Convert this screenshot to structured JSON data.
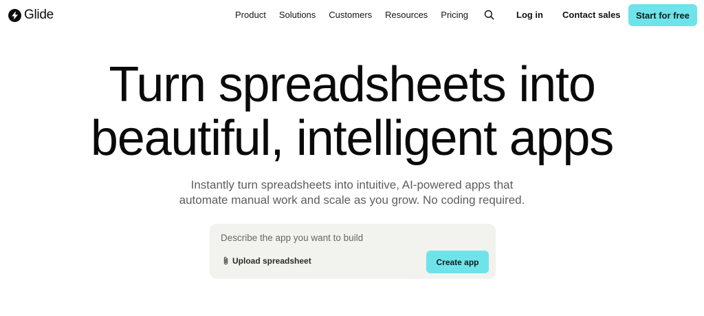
{
  "header": {
    "logo_text": "Glide",
    "logo_icon": "glide-logo-icon",
    "nav": [
      "Product",
      "Solutions",
      "Customers",
      "Resources",
      "Pricing"
    ],
    "search_icon": "search-icon",
    "login_label": "Log in",
    "contact_label": "Contact sales",
    "cta_label": "Start for free",
    "accent_color": "#6ee4ea"
  },
  "hero": {
    "title_line1": "Turn spreadsheets into",
    "title_line2": "beautiful, intelligent apps",
    "subtitle_line1": "Instantly turn spreadsheets into intuitive, AI-powered apps that",
    "subtitle_line2": "automate manual work and scale as you grow. No coding required."
  },
  "prompt": {
    "placeholder": "Describe the app you want to build",
    "upload_label": "Upload spreadsheet",
    "upload_icon": "paperclip-icon",
    "create_label": "Create app"
  }
}
